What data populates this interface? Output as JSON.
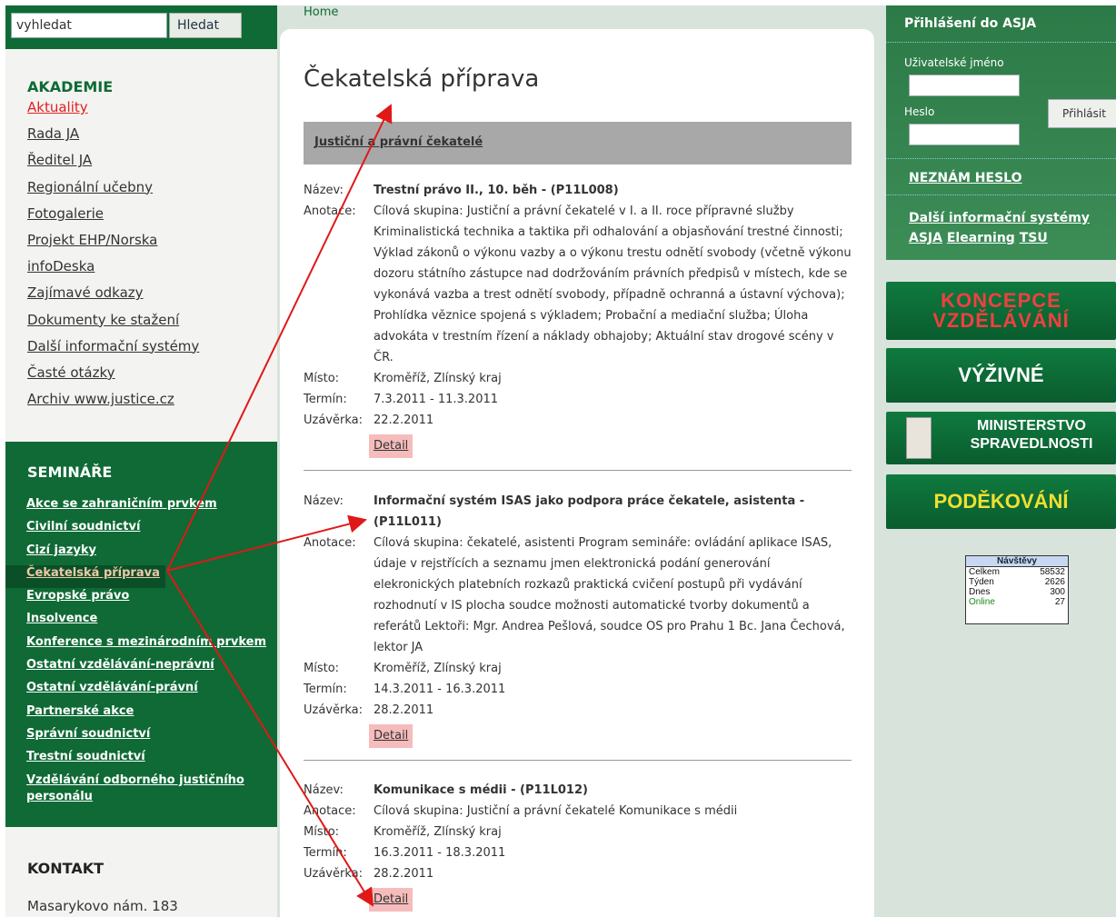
{
  "search": {
    "placeholder": "vyhledat",
    "value": "vyhledat",
    "button": "Hledat"
  },
  "breadcrumb": "Home",
  "akademie": {
    "title": "AKADEMIE",
    "items": [
      "Aktuality",
      "Rada JA",
      "Ředitel JA",
      "Regionální učebny",
      "Fotogalerie",
      "Projekt EHP/Norska",
      "infoDeska",
      "Zajímavé odkazy",
      "Dokumenty ke stažení",
      "Další informační systémy",
      "Časté otázky",
      "Archiv www.justice.cz"
    ]
  },
  "seminare": {
    "title": "SEMINÁŘE",
    "items": [
      "Akce se zahraničním prvkem",
      "Civilní soudnictví",
      "Cizí jazyky",
      "Čekatelská příprava",
      "Evropské právo",
      "Insolvence",
      "Konference s mezinárodním prvkem",
      "Ostatní vzdělávání-neprávní",
      "Ostatní vzdělávání-právní",
      "Partnerské akce",
      "Správní soudnictví",
      "Trestní soudnictví",
      "Vzdělávání odborného justičního personálu"
    ]
  },
  "kontakt": {
    "title": "KONTAKT",
    "address": "Masarykovo nám. 183"
  },
  "main": {
    "title": "Čekatelská příprava",
    "category": "Justiční a právní čekatelé",
    "labels": {
      "nazev": "Název:",
      "anotace": "Anotace:",
      "misto": "Místo:",
      "termin": "Termín:",
      "uzaverka": "Uzávěrka:"
    },
    "courses": [
      {
        "nazev": "Trestní právo II., 10. běh - (P11L008)",
        "anotace": "Cílová skupina: Justiční a právní čekatelé v I. a II. roce přípravné služby Kriminalistická technika a taktika při odhalování a objasňování trestné činnosti; Výklad zákonů o výkonu vazby a o výkonu trestu odnětí svobody (včetně výkonu dozoru státního zástupce nad dodržováním právních předpisů v místech, kde se vykonává vazba a trest odnětí svobody, případně ochranná a ústavní výchova); Prohlídka věznice spojená s výkladem; Probační a mediační služba; Úloha advokáta v trestním řízení a náklady obhajoby; Aktuální stav drogové scény v ČR.",
        "misto": "Kroměříž, Zlínský kraj",
        "termin": "7.3.2011 - 11.3.2011",
        "uzaverka": "22.2.2011",
        "detail": "Detail"
      },
      {
        "nazev": "Informační systém ISAS jako podpora práce čekatele, asistenta - (P11L011)",
        "anotace": "Cílová skupina: čekatelé, asistenti Program semináře: ovládání aplikace ISAS, údaje v rejstřících a seznamu jmen elektronická podání generování elekronických platebních rozkazů praktická cvičení postupů při vydávání rozhodnutí v IS plocha soudce možnosti automatické tvorby dokumentů a referátů Lektoři: Mgr. Andrea Pešlová, soudce OS pro Prahu 1 Bc. Jana Čechová, lektor JA",
        "misto": "Kroměříž, Zlínský kraj",
        "termin": "14.3.2011 - 16.3.2011",
        "uzaverka": "28.2.2011",
        "detail": "Detail"
      },
      {
        "nazev": "Komunikace s médii - (P11L012)",
        "anotace": "Cílová skupina: Justiční a právní čekatelé Komunikace s médii",
        "misto": "Kroměříž, Zlínský kraj",
        "termin": "16.3.2011 - 18.3.2011",
        "uzaverka": "28.2.2011",
        "detail": "Detail"
      }
    ]
  },
  "login": {
    "title": "Přihlášení do ASJA",
    "username_label": "Uživatelské jméno",
    "password_label": "Heslo",
    "submit": "Přihlásit",
    "forgot": "NEZNÁM HESLO",
    "other_systems": "Další informační systémy",
    "links": [
      "ASJA",
      "Elearning",
      "TSU"
    ]
  },
  "banners": {
    "koncepce": [
      "KONCEPCE",
      "VZDĚLÁVÁNÍ"
    ],
    "vyzivne": "VÝŽIVNÉ",
    "ministerstvo": [
      "MINISTERSTVO",
      "SPRAVEDLNOSTI"
    ],
    "podekovani": "PODĚKOVÁNÍ"
  },
  "counter": {
    "title": "Návštěvy",
    "rows": [
      {
        "label": "Celkem",
        "value": "58532"
      },
      {
        "label": "Týden",
        "value": "2626"
      },
      {
        "label": "Dnes",
        "value": "300"
      },
      {
        "label": "Online",
        "value": "27"
      }
    ]
  },
  "colors": {
    "green": "#0f6a35",
    "arrow": "#e01818",
    "highlight": "#f6bcbc"
  }
}
